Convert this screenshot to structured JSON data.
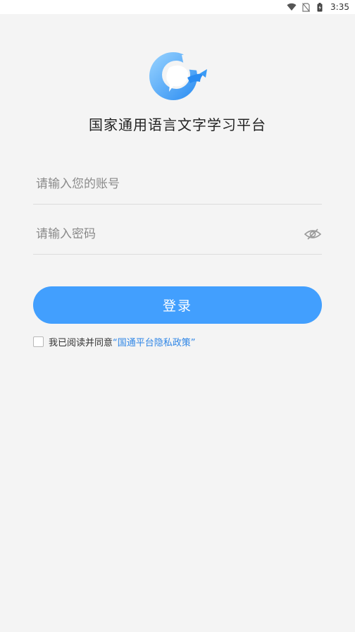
{
  "status_bar": {
    "time": "3:35",
    "icons": [
      "wifi-icon",
      "no-sim-icon",
      "battery-charging-icon"
    ]
  },
  "app": {
    "title": "国家通用语言文字学习平台",
    "logo": "dolphin-g-logo"
  },
  "login_form": {
    "account_placeholder": "请输入您的账号",
    "account_value": "",
    "password_placeholder": "请输入密码",
    "password_value": "",
    "password_toggle_icon": "eye-hidden-icon",
    "login_label": "登录"
  },
  "agreement": {
    "checked": false,
    "prefix": "我已阅读并同意",
    "link_text": "“国通平台隐私政策”"
  },
  "colors": {
    "background": "#f4f4f4",
    "primary": "#429ffe",
    "link": "#2f86e6"
  }
}
